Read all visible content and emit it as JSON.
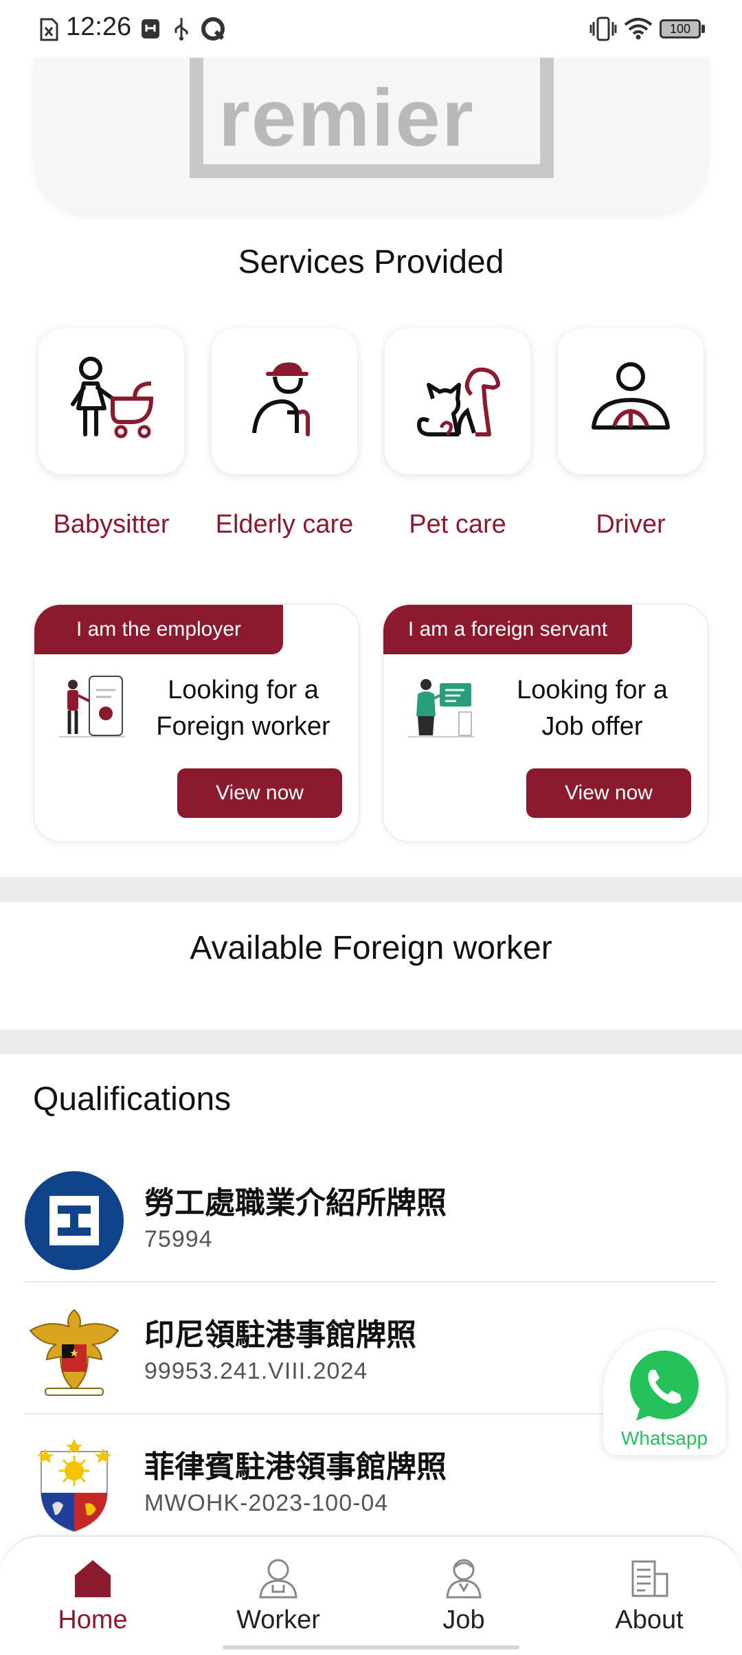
{
  "status_bar": {
    "time": "12:26",
    "battery": "100",
    "icons": [
      "sim-icon",
      "notification-icon",
      "usb-icon",
      "sync-icon",
      "vibrate-icon",
      "wifi-icon",
      "battery-icon"
    ]
  },
  "banner": {
    "text": "remier"
  },
  "services": {
    "title": "Services Provided",
    "items": [
      {
        "label": "Babysitter",
        "icon": "babysitter-icon"
      },
      {
        "label": "Elderly care",
        "icon": "elderly-care-icon"
      },
      {
        "label": "Pet care",
        "icon": "pet-care-icon"
      },
      {
        "label": "Driver",
        "icon": "driver-icon"
      }
    ]
  },
  "cards": [
    {
      "tag": "I am the employer",
      "title_line1": "Looking for a",
      "title_line2": "Foreign worker",
      "button": "View now"
    },
    {
      "tag": "I am a foreign servant",
      "title_line1": "Looking for a",
      "title_line2": "Job offer",
      "button": "View now"
    }
  ],
  "available": {
    "title": "Available Foreign worker"
  },
  "qualifications": {
    "title": "Qualifications",
    "items": [
      {
        "name": "勞工處職業介紹所牌照",
        "code": "75994"
      },
      {
        "name": "印尼領駐港事館牌照",
        "code": "99953.241.VIII.2024"
      },
      {
        "name": "菲律賓駐港領事館牌照",
        "code": "MWOHK-2023-100-04"
      }
    ]
  },
  "whatsapp": {
    "label": "Whatsapp",
    "color": "#25c15b"
  },
  "nav": {
    "items": [
      {
        "label": "Home",
        "active": true
      },
      {
        "label": "Worker",
        "active": false
      },
      {
        "label": "Job",
        "active": false
      },
      {
        "label": "About",
        "active": false
      }
    ]
  },
  "colors": {
    "accent": "#8b1a2e",
    "whatsapp": "#25c15b"
  }
}
